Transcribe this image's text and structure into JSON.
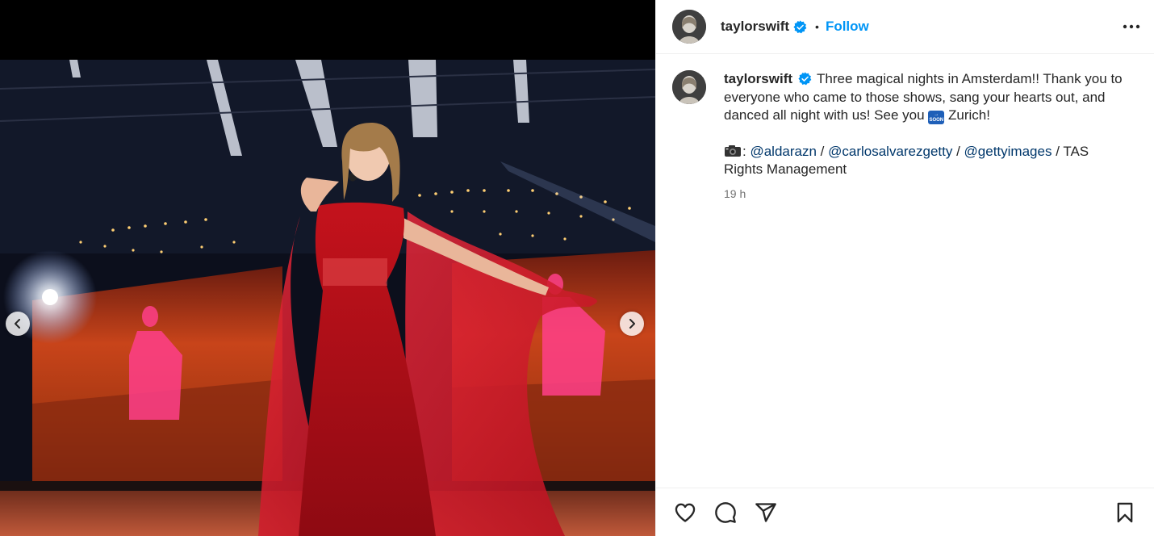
{
  "post": {
    "username": "taylorswift",
    "separator": "•",
    "follow_label": "Follow",
    "caption_text": "Three magical nights in Amsterdam!! Thank you to everyone who came to those shows, sang your hearts out, and danced all night with us! See you",
    "soon_emoji_text": "SOON",
    "caption_end": "Zurich!",
    "credit_prefix": ":",
    "mentions": [
      "@aldarazn",
      "@carlosalvarezgetty",
      "@gettyimages"
    ],
    "credit_sep": " / ",
    "credit_suffix": " / TAS Rights Management",
    "timestamp": "19 h"
  },
  "icons": {
    "verified": "verified-badge-icon",
    "more": "more-options-icon",
    "camera": "camera-emoji-icon",
    "soon": "soon-arrow-emoji-icon",
    "prev": "chevron-left-icon",
    "next": "chevron-right-icon",
    "like": "heart-icon",
    "comment": "comment-icon",
    "share": "share-icon",
    "save": "bookmark-icon"
  },
  "colors": {
    "accent": "#0095f6",
    "verified": "#0095f6",
    "mention": "#00376b",
    "muted": "#737373"
  }
}
